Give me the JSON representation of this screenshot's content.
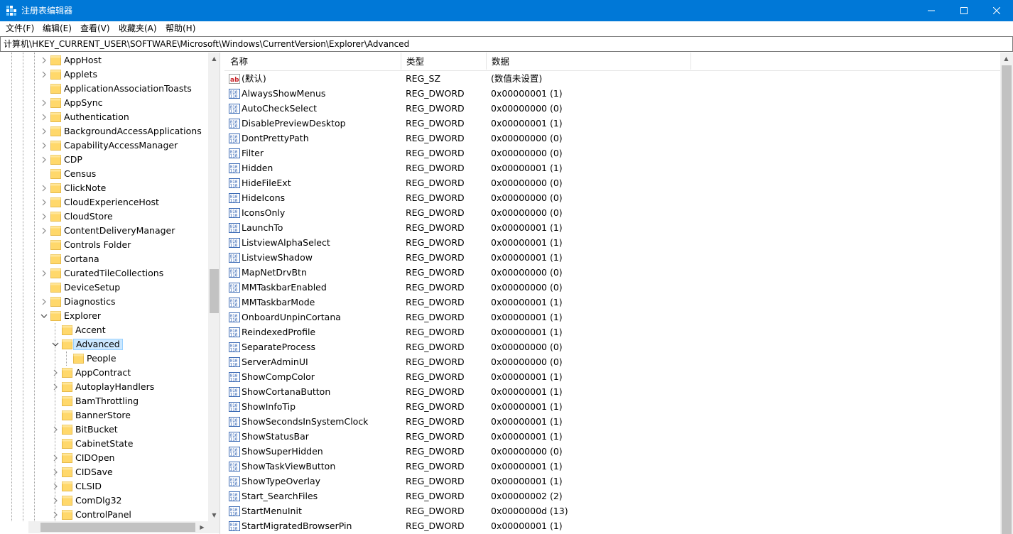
{
  "window": {
    "title": "注册表编辑器"
  },
  "menu": [
    "文件(F)",
    "编辑(E)",
    "查看(V)",
    "收藏夹(A)",
    "帮助(H)"
  ],
  "address": "计算机\\HKEY_CURRENT_USER\\SOFTWARE\\Microsoft\\Windows\\CurrentVersion\\Explorer\\Advanced",
  "tree": [
    {
      "label": "AppHost",
      "level": 1,
      "expander": "collapsed"
    },
    {
      "label": "Applets",
      "level": 1,
      "expander": "collapsed"
    },
    {
      "label": "ApplicationAssociationToasts",
      "level": 1,
      "expander": "none"
    },
    {
      "label": "AppSync",
      "level": 1,
      "expander": "collapsed"
    },
    {
      "label": "Authentication",
      "level": 1,
      "expander": "collapsed"
    },
    {
      "label": "BackgroundAccessApplications",
      "level": 1,
      "expander": "collapsed"
    },
    {
      "label": "CapabilityAccessManager",
      "level": 1,
      "expander": "collapsed"
    },
    {
      "label": "CDP",
      "level": 1,
      "expander": "collapsed"
    },
    {
      "label": "Census",
      "level": 1,
      "expander": "none"
    },
    {
      "label": "ClickNote",
      "level": 1,
      "expander": "collapsed"
    },
    {
      "label": "CloudExperienceHost",
      "level": 1,
      "expander": "collapsed"
    },
    {
      "label": "CloudStore",
      "level": 1,
      "expander": "collapsed"
    },
    {
      "label": "ContentDeliveryManager",
      "level": 1,
      "expander": "collapsed"
    },
    {
      "label": "Controls Folder",
      "level": 1,
      "expander": "none"
    },
    {
      "label": "Cortana",
      "level": 1,
      "expander": "none"
    },
    {
      "label": "CuratedTileCollections",
      "level": 1,
      "expander": "collapsed"
    },
    {
      "label": "DeviceSetup",
      "level": 1,
      "expander": "none"
    },
    {
      "label": "Diagnostics",
      "level": 1,
      "expander": "collapsed"
    },
    {
      "label": "Explorer",
      "level": 1,
      "expander": "expanded"
    },
    {
      "label": "Accent",
      "level": 2,
      "expander": "none"
    },
    {
      "label": "Advanced",
      "level": 2,
      "expander": "expanded",
      "selected": true
    },
    {
      "label": "People",
      "level": 3,
      "expander": "none"
    },
    {
      "label": "AppContract",
      "level": 2,
      "expander": "collapsed"
    },
    {
      "label": "AutoplayHandlers",
      "level": 2,
      "expander": "collapsed"
    },
    {
      "label": "BamThrottling",
      "level": 2,
      "expander": "none"
    },
    {
      "label": "BannerStore",
      "level": 2,
      "expander": "none"
    },
    {
      "label": "BitBucket",
      "level": 2,
      "expander": "collapsed"
    },
    {
      "label": "CabinetState",
      "level": 2,
      "expander": "none"
    },
    {
      "label": "CIDOpen",
      "level": 2,
      "expander": "collapsed"
    },
    {
      "label": "CIDSave",
      "level": 2,
      "expander": "collapsed"
    },
    {
      "label": "CLSID",
      "level": 2,
      "expander": "collapsed"
    },
    {
      "label": "ComDlg32",
      "level": 2,
      "expander": "collapsed"
    },
    {
      "label": "ControlPanel",
      "level": 2,
      "expander": "collapsed"
    }
  ],
  "list": {
    "columns": [
      "名称",
      "类型",
      "数据"
    ],
    "rows": [
      {
        "icon": "string-value-icon",
        "name": "(默认)",
        "type": "REG_SZ",
        "data": "(数值未设置)"
      },
      {
        "icon": "binary-value-icon",
        "name": "AlwaysShowMenus",
        "type": "REG_DWORD",
        "data": "0x00000001 (1)"
      },
      {
        "icon": "binary-value-icon",
        "name": "AutoCheckSelect",
        "type": "REG_DWORD",
        "data": "0x00000000 (0)"
      },
      {
        "icon": "binary-value-icon",
        "name": "DisablePreviewDesktop",
        "type": "REG_DWORD",
        "data": "0x00000001 (1)"
      },
      {
        "icon": "binary-value-icon",
        "name": "DontPrettyPath",
        "type": "REG_DWORD",
        "data": "0x00000000 (0)"
      },
      {
        "icon": "binary-value-icon",
        "name": "Filter",
        "type": "REG_DWORD",
        "data": "0x00000000 (0)"
      },
      {
        "icon": "binary-value-icon",
        "name": "Hidden",
        "type": "REG_DWORD",
        "data": "0x00000001 (1)"
      },
      {
        "icon": "binary-value-icon",
        "name": "HideFileExt",
        "type": "REG_DWORD",
        "data": "0x00000000 (0)"
      },
      {
        "icon": "binary-value-icon",
        "name": "HideIcons",
        "type": "REG_DWORD",
        "data": "0x00000000 (0)"
      },
      {
        "icon": "binary-value-icon",
        "name": "IconsOnly",
        "type": "REG_DWORD",
        "data": "0x00000000 (0)"
      },
      {
        "icon": "binary-value-icon",
        "name": "LaunchTo",
        "type": "REG_DWORD",
        "data": "0x00000001 (1)"
      },
      {
        "icon": "binary-value-icon",
        "name": "ListviewAlphaSelect",
        "type": "REG_DWORD",
        "data": "0x00000001 (1)"
      },
      {
        "icon": "binary-value-icon",
        "name": "ListviewShadow",
        "type": "REG_DWORD",
        "data": "0x00000001 (1)"
      },
      {
        "icon": "binary-value-icon",
        "name": "MapNetDrvBtn",
        "type": "REG_DWORD",
        "data": "0x00000000 (0)"
      },
      {
        "icon": "binary-value-icon",
        "name": "MMTaskbarEnabled",
        "type": "REG_DWORD",
        "data": "0x00000000 (0)"
      },
      {
        "icon": "binary-value-icon",
        "name": "MMTaskbarMode",
        "type": "REG_DWORD",
        "data": "0x00000001 (1)"
      },
      {
        "icon": "binary-value-icon",
        "name": "OnboardUnpinCortana",
        "type": "REG_DWORD",
        "data": "0x00000001 (1)"
      },
      {
        "icon": "binary-value-icon",
        "name": "ReindexedProfile",
        "type": "REG_DWORD",
        "data": "0x00000001 (1)"
      },
      {
        "icon": "binary-value-icon",
        "name": "SeparateProcess",
        "type": "REG_DWORD",
        "data": "0x00000000 (0)"
      },
      {
        "icon": "binary-value-icon",
        "name": "ServerAdminUI",
        "type": "REG_DWORD",
        "data": "0x00000000 (0)"
      },
      {
        "icon": "binary-value-icon",
        "name": "ShowCompColor",
        "type": "REG_DWORD",
        "data": "0x00000001 (1)"
      },
      {
        "icon": "binary-value-icon",
        "name": "ShowCortanaButton",
        "type": "REG_DWORD",
        "data": "0x00000001 (1)"
      },
      {
        "icon": "binary-value-icon",
        "name": "ShowInfoTip",
        "type": "REG_DWORD",
        "data": "0x00000001 (1)"
      },
      {
        "icon": "binary-value-icon",
        "name": "ShowSecondsInSystemClock",
        "type": "REG_DWORD",
        "data": "0x00000001 (1)"
      },
      {
        "icon": "binary-value-icon",
        "name": "ShowStatusBar",
        "type": "REG_DWORD",
        "data": "0x00000001 (1)"
      },
      {
        "icon": "binary-value-icon",
        "name": "ShowSuperHidden",
        "type": "REG_DWORD",
        "data": "0x00000000 (0)"
      },
      {
        "icon": "binary-value-icon",
        "name": "ShowTaskViewButton",
        "type": "REG_DWORD",
        "data": "0x00000001 (1)"
      },
      {
        "icon": "binary-value-icon",
        "name": "ShowTypeOverlay",
        "type": "REG_DWORD",
        "data": "0x00000001 (1)"
      },
      {
        "icon": "binary-value-icon",
        "name": "Start_SearchFiles",
        "type": "REG_DWORD",
        "data": "0x00000002 (2)"
      },
      {
        "icon": "binary-value-icon",
        "name": "StartMenuInit",
        "type": "REG_DWORD",
        "data": "0x0000000d (13)"
      },
      {
        "icon": "binary-value-icon",
        "name": "StartMigratedBrowserPin",
        "type": "REG_DWORD",
        "data": "0x00000001 (1)"
      }
    ]
  },
  "colors": {
    "titlebar": "#0078d7",
    "folder": "#ffd86b",
    "selection": "#cce8ff"
  }
}
